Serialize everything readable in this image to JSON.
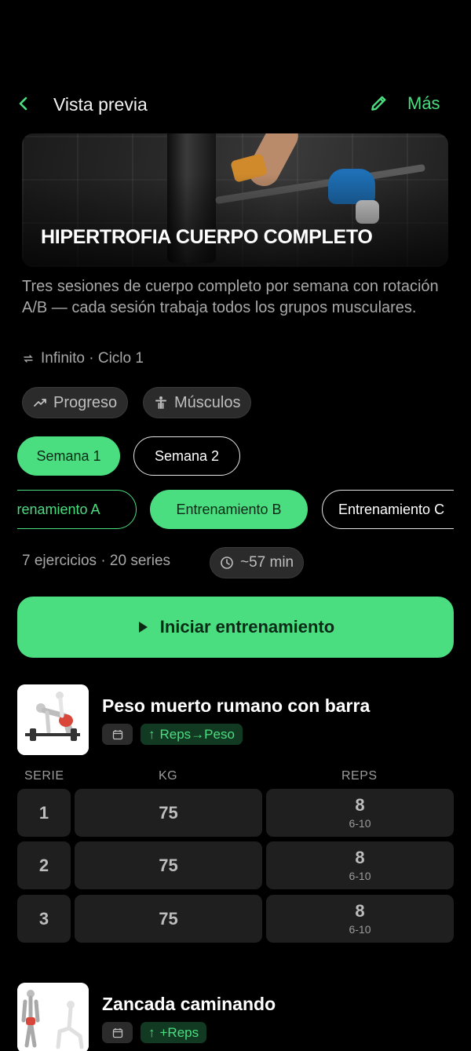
{
  "header": {
    "title": "Vista previa",
    "more_label": "Más"
  },
  "program": {
    "title": "HIPERTROFIA CUERPO COMPLETO",
    "description": "Tres sesiones de cuerpo completo por semana con rotación A/B — cada sesión trabaja todos los grupos musculares.",
    "cycle": "Infinito · Ciclo 1"
  },
  "chips": {
    "progress": "Progreso",
    "muscles": "Músculos"
  },
  "weeks": [
    {
      "label": "Semana 1",
      "active": true
    },
    {
      "label": "Semana 2",
      "active": false
    }
  ],
  "workouts": [
    {
      "label": "Entrenamiento A"
    },
    {
      "label": "Entrenamiento B",
      "active": true
    },
    {
      "label": "Entrenamiento C"
    }
  ],
  "summary": {
    "text": "7 ejercicios · 20 series",
    "time": "~57 min"
  },
  "start_button": "Iniciar entrenamiento",
  "table_headers": {
    "serie": "SERIE",
    "kg": "KG",
    "reps": "REPS"
  },
  "exercises": [
    {
      "name": "Peso muerto rumano con barra",
      "progression": "Reps→Peso",
      "sets": [
        {
          "serie": "1",
          "kg": "75",
          "reps": "8",
          "range": "6-10"
        },
        {
          "serie": "2",
          "kg": "75",
          "reps": "8",
          "range": "6-10"
        },
        {
          "serie": "3",
          "kg": "75",
          "reps": "8",
          "range": "6-10"
        }
      ]
    },
    {
      "name": "Zancada caminando",
      "progression": "+Reps"
    }
  ],
  "colors": {
    "accent": "#4ade80",
    "background": "#000000",
    "card": "#1f1f1f"
  }
}
